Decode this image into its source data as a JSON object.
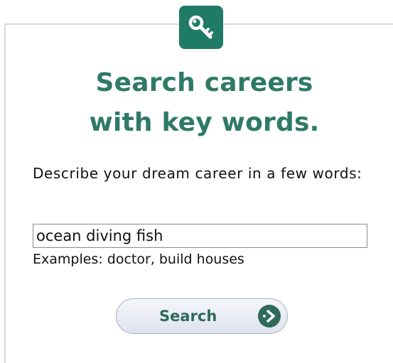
{
  "header": {
    "icon": "key-icon",
    "title_line1": "Search careers",
    "title_line2": "with key words."
  },
  "form": {
    "prompt": "Describe your dream career in a few words:",
    "input_value": "ocean diving fish",
    "examples": "Examples: doctor, build houses",
    "button_label": "Search",
    "button_icon": "arrow-right-circle-icon"
  },
  "colors": {
    "accent_green": "#1f7a66",
    "heading_green": "#2f7a66"
  }
}
